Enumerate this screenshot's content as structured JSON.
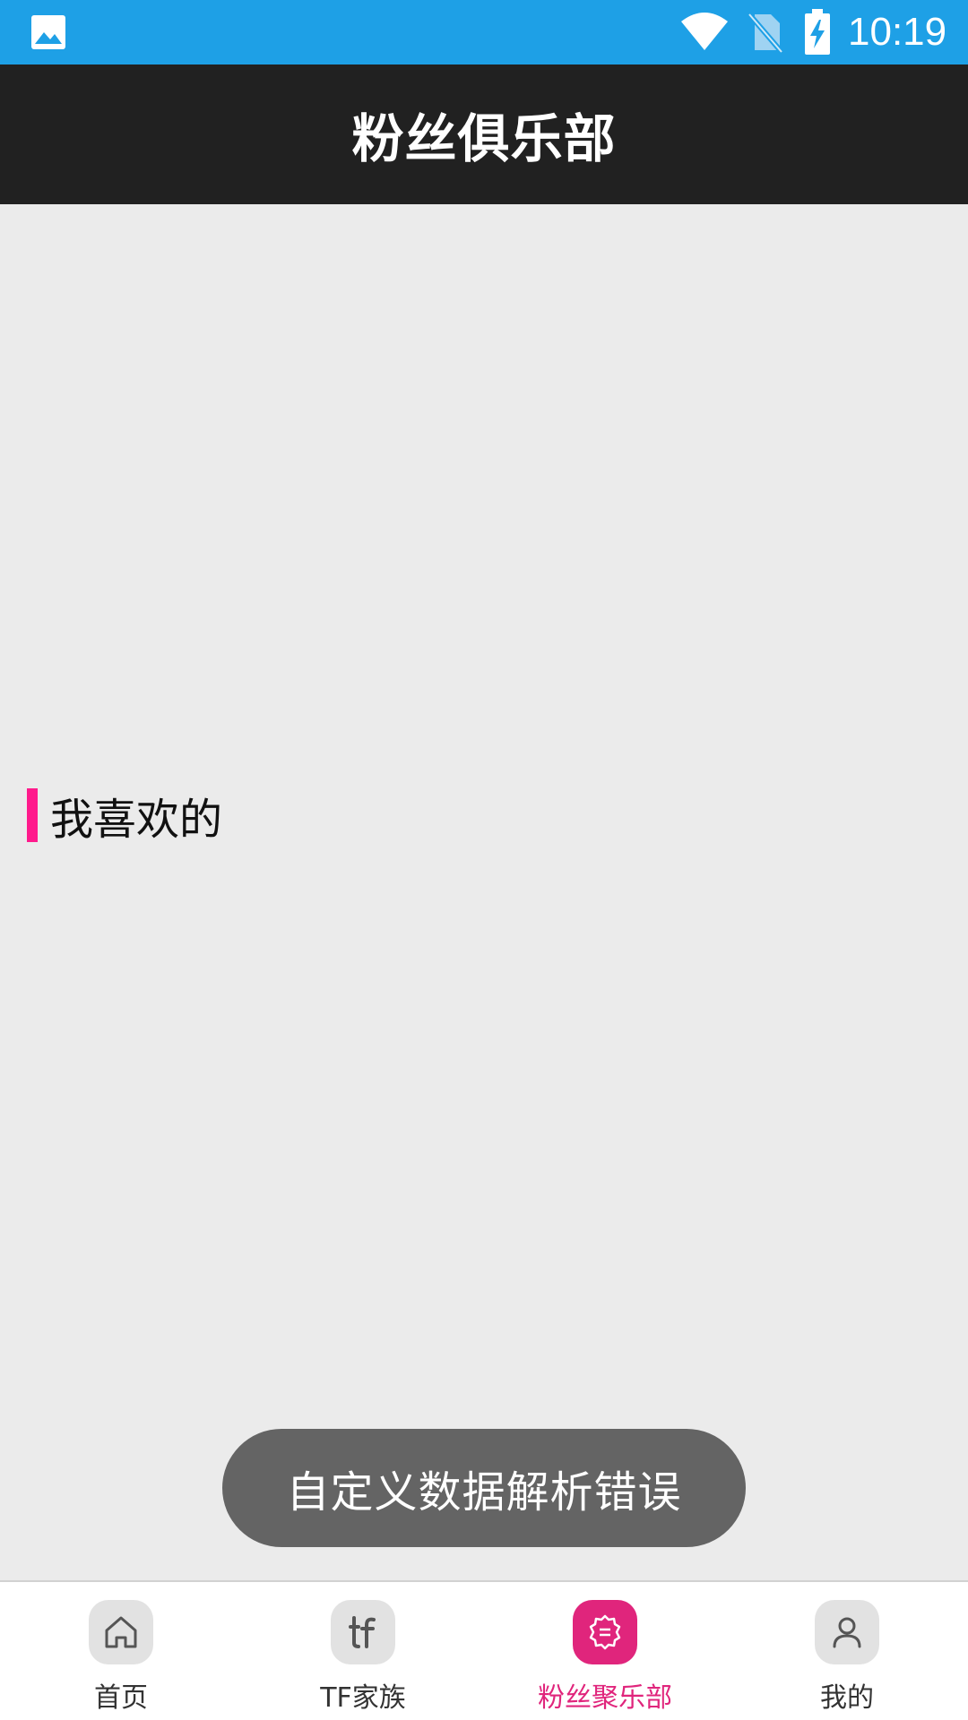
{
  "status_bar": {
    "time": "10:19",
    "icons": [
      "gallery-icon",
      "wifi-icon",
      "no-sim-icon",
      "battery-charging-icon"
    ]
  },
  "app_bar": {
    "title": "粉丝俱乐部"
  },
  "section": {
    "title": "我喜欢的",
    "accent_color": "#ff1a8c"
  },
  "toast": {
    "message": "自定义数据解析错误"
  },
  "bottom_nav": {
    "active_color": "#e0257c",
    "items": [
      {
        "label": "首页",
        "icon": "home-icon",
        "active": false
      },
      {
        "label": "TF家族",
        "icon": "tf-logo-icon",
        "active": false
      },
      {
        "label": "粉丝聚乐部",
        "icon": "badge-icon",
        "active": true
      },
      {
        "label": "我的",
        "icon": "user-icon",
        "active": false
      }
    ]
  },
  "colors": {
    "status_bar": "#1ea0e6",
    "app_bar": "#212121",
    "background": "#ebebeb"
  }
}
